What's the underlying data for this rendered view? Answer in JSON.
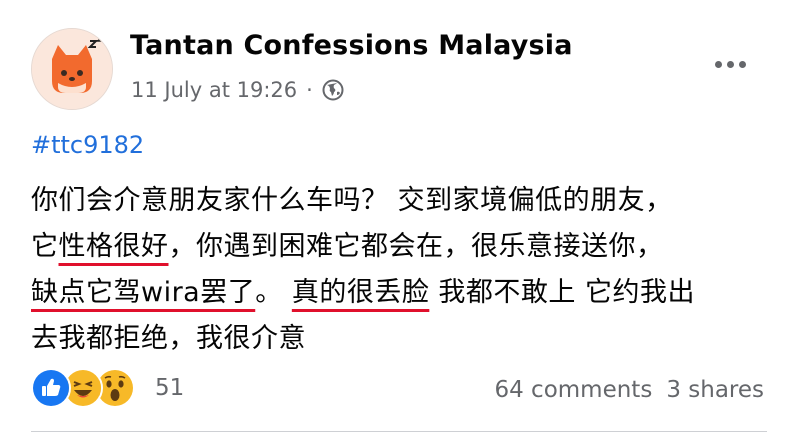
{
  "post": {
    "page_name": "Tantan Confessions Malaysia",
    "timestamp": "11 July at 19:26",
    "meta_separator": "·",
    "audience_icon": "globe-icon",
    "avatar_icon": "tantan-fox-logo",
    "more_icon": "more-dots-icon",
    "hashtag": "#ttc9182",
    "text": {
      "line1": "你们会介意朋友家什么车吗？ 交到家境偏低的朋友，",
      "line2_a": "它",
      "line2_hl": "性格很好",
      "line2_b": "，你遇到困难它都会在，很乐意接送你，",
      "line3_hl1": "缺点它驾wira罢了",
      "line3_b": "。 ",
      "line3_hl2": "真的很丢脸",
      "line3_c": " 我都不敢上 它约我出",
      "line4": "去我都拒绝，我很介意"
    },
    "underline_color": "#e0102c"
  },
  "footer": {
    "reaction_icons": [
      "like-icon",
      "laugh-icon",
      "wow-icon"
    ],
    "reaction_count": "51",
    "comments": "64 comments",
    "shares": "3 shares"
  },
  "colors": {
    "link_blue": "#216fdb",
    "secondary_text": "#65676b",
    "primary_text": "#050505",
    "like_blue": "#1877f2",
    "emoji_yellow": "#f7b928"
  }
}
